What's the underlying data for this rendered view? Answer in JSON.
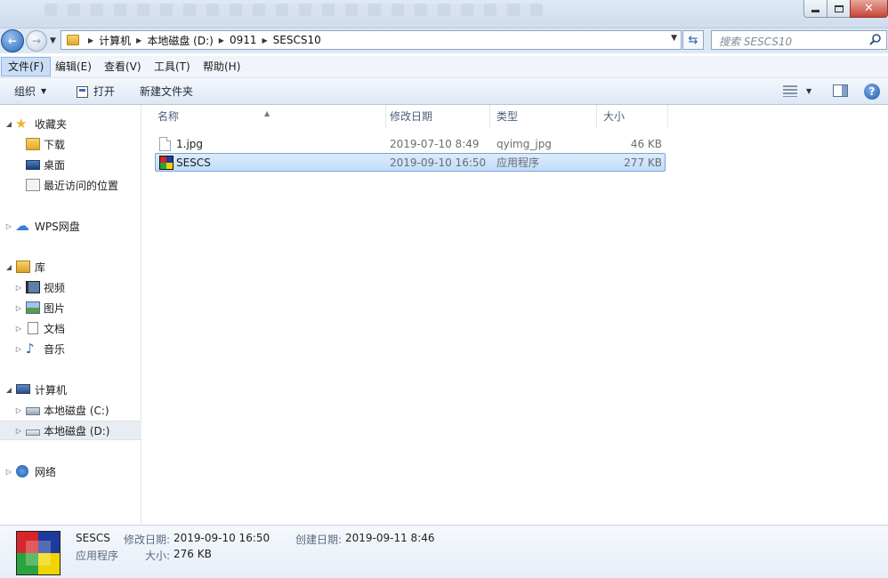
{
  "address": {
    "crumbs": [
      "计算机",
      "本地磁盘 (D:)",
      "0911",
      "SESCS10"
    ]
  },
  "search": {
    "placeholder": "搜索 SESCS10"
  },
  "menu": [
    "文件(F)",
    "编辑(E)",
    "查看(V)",
    "工具(T)",
    "帮助(H)"
  ],
  "toolbar": {
    "organize": "组织",
    "open": "打开",
    "new_folder": "新建文件夹"
  },
  "sidebar": {
    "favorites": {
      "label": "收藏夹",
      "items": [
        "下载",
        "桌面",
        "最近访问的位置"
      ]
    },
    "wps": {
      "label": "WPS网盘"
    },
    "libraries": {
      "label": "库",
      "items": [
        "视频",
        "图片",
        "文档",
        "音乐"
      ]
    },
    "computer": {
      "label": "计算机",
      "items": [
        "本地磁盘 (C:)",
        "本地磁盘 (D:)"
      ]
    },
    "network": {
      "label": "网络"
    }
  },
  "columns": {
    "name": "名称",
    "modified": "修改日期",
    "type": "类型",
    "size": "大小"
  },
  "files": [
    {
      "name": "1.jpg",
      "modified": "2019-07-10 8:49",
      "type": "qyimg_jpg",
      "size": "46 KB"
    },
    {
      "name": "SESCS",
      "modified": "2019-09-10 16:50",
      "type": "应用程序",
      "size": "277 KB"
    }
  ],
  "details": {
    "name": "SESCS",
    "type": "应用程序",
    "modified_label": "修改日期:",
    "modified_value": "2019-09-10 16:50",
    "created_label": "创建日期:",
    "created_value": "2019-09-11 8:46",
    "size_label": "大小:",
    "size_value": "276 KB"
  },
  "icons": {
    "back": "back-arrow-icon",
    "forward": "forward-arrow-icon",
    "refresh": "refresh-icon",
    "search": "search-icon",
    "help": "help-icon"
  },
  "colors": {
    "selection": "#cce4fb",
    "accent": "#2a66b8"
  }
}
